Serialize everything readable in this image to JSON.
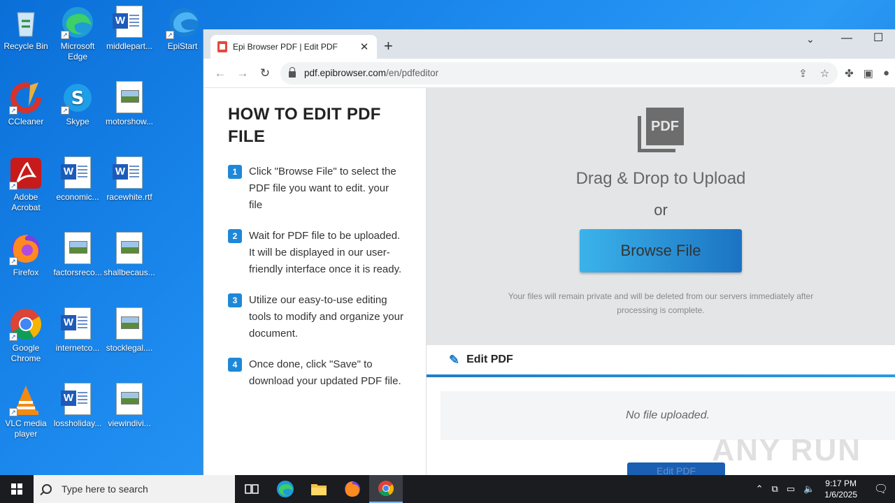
{
  "desktop": {
    "icons": [
      {
        "label": "Recycle Bin",
        "icon": "recycle-bin-icon"
      },
      {
        "label": "Microsoft Edge",
        "icon": "edge-icon"
      },
      {
        "label": "middlepart...",
        "icon": "word-doc-icon"
      },
      {
        "label": "EpiStart",
        "icon": "epistart-icon"
      },
      {
        "label": "CCleaner",
        "icon": "ccleaner-icon"
      },
      {
        "label": "Skype",
        "icon": "skype-icon"
      },
      {
        "label": "motorshow...",
        "icon": "image-file-icon"
      },
      {
        "label": "Adobe Acrobat",
        "icon": "acrobat-icon"
      },
      {
        "label": "economic...",
        "icon": "word-doc-icon"
      },
      {
        "label": "racewhite.rtf",
        "icon": "word-doc-icon"
      },
      {
        "label": "Firefox",
        "icon": "firefox-icon"
      },
      {
        "label": "factorsreco...",
        "icon": "image-file-icon"
      },
      {
        "label": "shallbecaus...",
        "icon": "image-file-icon"
      },
      {
        "label": "Google Chrome",
        "icon": "chrome-icon"
      },
      {
        "label": "internetco...",
        "icon": "word-doc-icon"
      },
      {
        "label": "stocklegal....",
        "icon": "image-file-icon"
      },
      {
        "label": "VLC media player",
        "icon": "vlc-icon"
      },
      {
        "label": "lossholiday...",
        "icon": "word-doc-icon"
      },
      {
        "label": "viewindivi...",
        "icon": "image-file-icon"
      }
    ]
  },
  "browser": {
    "tab_title": "Epi Browser PDF | Edit PDF",
    "url_host": "pdf.epibrowser.com",
    "url_path": "/en/pdfeditor"
  },
  "page": {
    "heading": "HOW TO EDIT PDF FILE",
    "steps": [
      {
        "num": "1",
        "text": "Click \"Browse File\" to select the PDF file you want to edit. your file"
      },
      {
        "num": "2",
        "text": "Wait for PDF file to be uploaded. It will be displayed in our user-friendly interface once it is ready."
      },
      {
        "num": "3",
        "text": "Utilize our easy-to-use editing tools to modify and organize your document."
      },
      {
        "num": "4",
        "text": "Once done, click \"Save\" to download your updated PDF file."
      }
    ],
    "pdf_icon_text": "PDF",
    "drag_text": "Drag & Drop to Upload",
    "or_text": "or",
    "browse_label": "Browse File",
    "privacy_text": "Your files will remain private and will be deleted from our servers immediately after processing is complete.",
    "edit_title": "Edit PDF",
    "no_file_text": "No file uploaded.",
    "edit_button": "Edit PDF",
    "watermark": "ANY RUN"
  },
  "taskbar": {
    "search_placeholder": "Type here to search",
    "time": "9:17 PM",
    "date": "1/6/2025"
  }
}
